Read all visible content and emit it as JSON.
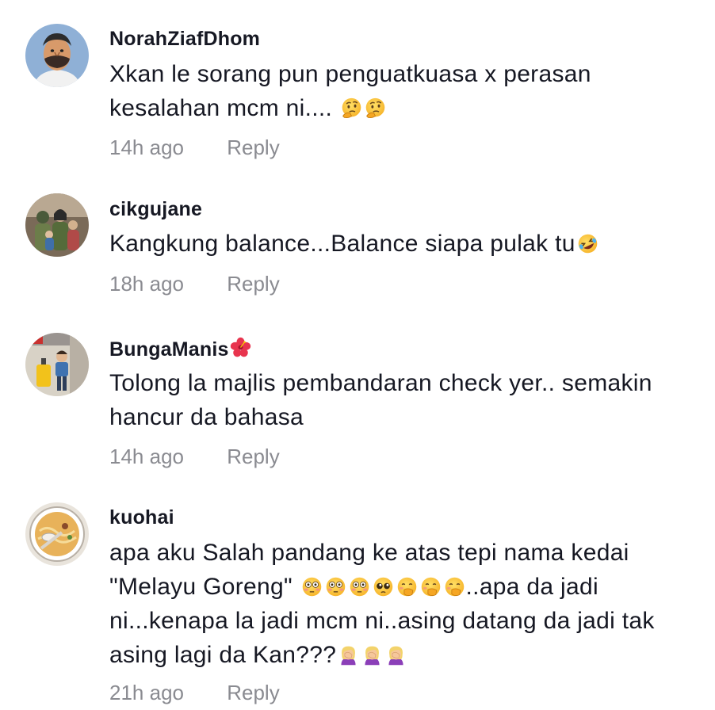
{
  "comments": [
    {
      "username": "NorahZiafDhom",
      "avatar": "caricature-man-avatar",
      "lines": [
        "Xkan le sorang pun penguatkuasa x perasan",
        "kesalahan mcm ni.... "
      ],
      "emojis": [
        "thinking-face",
        "thinking-face"
      ],
      "time": "14h ago",
      "reply": "Reply"
    },
    {
      "username": "cikgujane",
      "avatar": "family-photo-avatar",
      "lines": [
        "Kangkung balance...Balance siapa pulak tu"
      ],
      "emojis": [
        "rolling-laughing-face"
      ],
      "time": "18h ago",
      "reply": "Reply"
    },
    {
      "username": "BungaManis",
      "username_emoji": "hibiscus",
      "avatar": "child-luggage-avatar",
      "lines": [
        "Tolong la majlis pembandaran check yer.. semakin",
        "hancur da bahasa"
      ],
      "time": "14h ago",
      "reply": "Reply"
    },
    {
      "username": "kuohai",
      "avatar": "noodle-bowl-avatar",
      "lines": [
        "apa aku Salah pandang ke atas tepi nama kedai",
        "\"Melayu Goreng\" ",
        "..apa da jadi",
        "ni...kenapa la jadi mcm ni..asing datang da jadi tak",
        "asing lagi da Kan???"
      ],
      "emojis_line2": [
        "flushed-face",
        "flushed-face",
        "flushed-face",
        "pleading-face",
        "hand-over-mouth-face",
        "hand-over-mouth-face",
        "hand-over-mouth-face"
      ],
      "emojis_line5": [
        "woman-facepalming",
        "woman-facepalming",
        "woman-facepalming"
      ],
      "time": "21h ago",
      "reply": "Reply"
    }
  ],
  "colors": {
    "text": "#161823",
    "meta": "#8a8b91",
    "background": "#ffffff"
  }
}
